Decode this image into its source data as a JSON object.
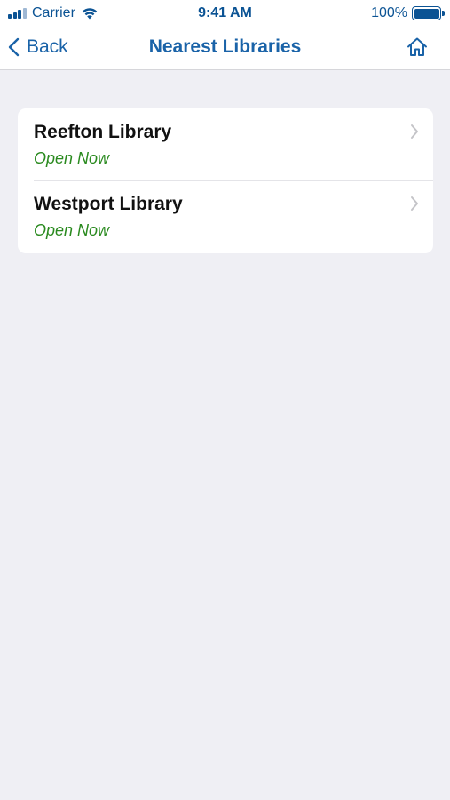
{
  "status_bar": {
    "carrier": "Carrier",
    "time": "9:41 AM",
    "battery": "100%",
    "battery_level": 1.0
  },
  "nav": {
    "back_label": "Back",
    "title": "Nearest Libraries",
    "home_icon": "home-icon"
  },
  "libraries": [
    {
      "name": "Reefton Library",
      "status": "Open Now"
    },
    {
      "name": "Westport Library",
      "status": "Open Now"
    }
  ],
  "colors": {
    "accent": "#1a63a8",
    "open_status": "#2a8a1f",
    "background": "#efeff4"
  }
}
